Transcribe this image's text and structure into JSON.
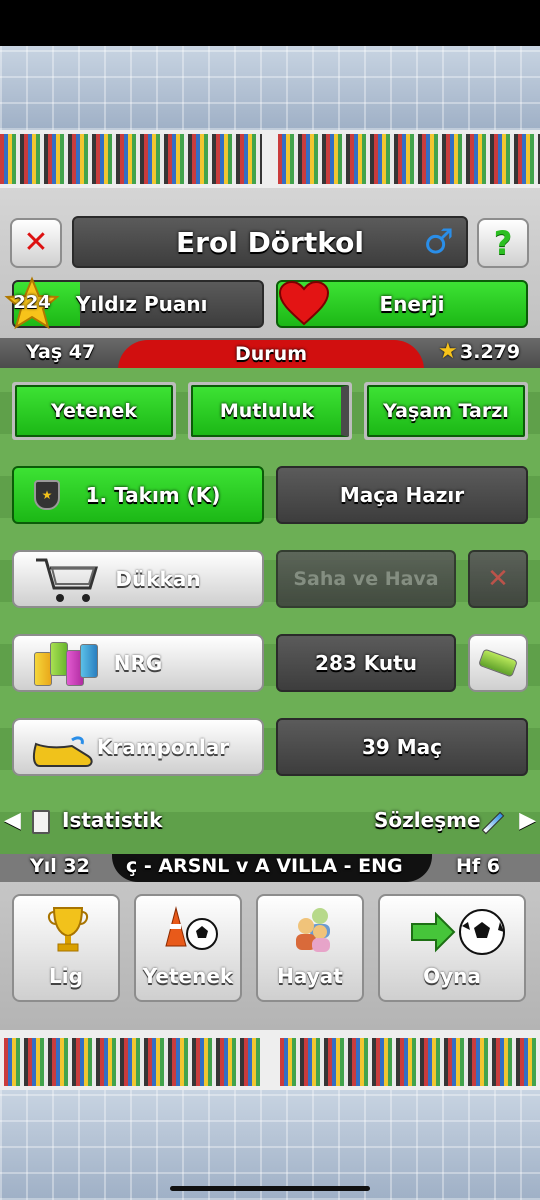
{
  "player": {
    "name": "Erol Dörtkol",
    "gender_icon": "male-symbol-icon"
  },
  "stats": {
    "star_points": "224",
    "star_label": "Yıldız Puanı",
    "energy_label": "Enerji",
    "age": "Yaş 47",
    "status_label": "Durum",
    "money": "3.279"
  },
  "tabs": {
    "skill": "Yetenek",
    "happiness": "Mutluluk",
    "lifestyle": "Yaşam Tarzı"
  },
  "team": {
    "label": "1. Takım (K)",
    "match_ready": "Maça Hazır"
  },
  "shop": {
    "label": "Dükkan",
    "field_weather": "Saha ve Hava"
  },
  "nrg": {
    "label": "NRG",
    "count": "283 Kutu"
  },
  "boots": {
    "label": "Kramponlar",
    "matches": "39 Maç"
  },
  "links": {
    "stats": "Istatistik",
    "contract": "Sözleşme"
  },
  "ticker": {
    "year": "Yıl 32",
    "news": "ç - ARSNL v A VILLA - ENG",
    "week": "Hf 6"
  },
  "bottom_nav": {
    "league": "Lig",
    "skill": "Yetenek",
    "life": "Hayat",
    "play": "Oyna"
  },
  "colors": {
    "accent_green": "#1cb816",
    "status_red": "#d10f0f",
    "dark_button": "#4a4a4a"
  }
}
